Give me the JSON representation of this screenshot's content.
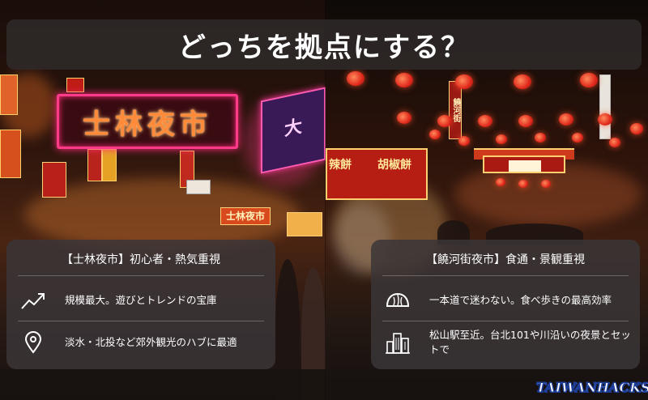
{
  "title": "どっちを拠点にする？",
  "left_card": {
    "heading": "【士林夜市】初心者・熱気重視",
    "rows": [
      {
        "icon": "trending-up-icon",
        "text": "規模最大。遊びとトレンドの宝庫"
      },
      {
        "icon": "map-pin-icon",
        "text": "淡水・北投など郊外観光のハブに最適"
      }
    ]
  },
  "right_card": {
    "heading": "【饒河街夜市】食通・景観重視",
    "rows": [
      {
        "icon": "bun-icon",
        "text": "一本道で迷わない。食べ歩きの最高効率"
      },
      {
        "icon": "city-buildings-icon",
        "text": "松山駅至近。台北101や川沿いの夜景とセットで"
      }
    ]
  },
  "photo_left": {
    "main_sign": "士林夜市",
    "sign_daxin": "大",
    "sign_shilin_small": "士林夜市"
  },
  "photo_right": {
    "shop_sign_a": "辣餅",
    "shop_sign_b": "胡椒餅",
    "street_sign": "饒河街"
  },
  "logo": {
    "text": "TAIWANHACKS"
  },
  "colors": {
    "neon_pink": "#ff3b8a",
    "neon_orange": "#ff8a3a",
    "lantern_red": "#e0281c",
    "card_bg": "#3a3638",
    "logo_blue": "#1d3f9a"
  }
}
